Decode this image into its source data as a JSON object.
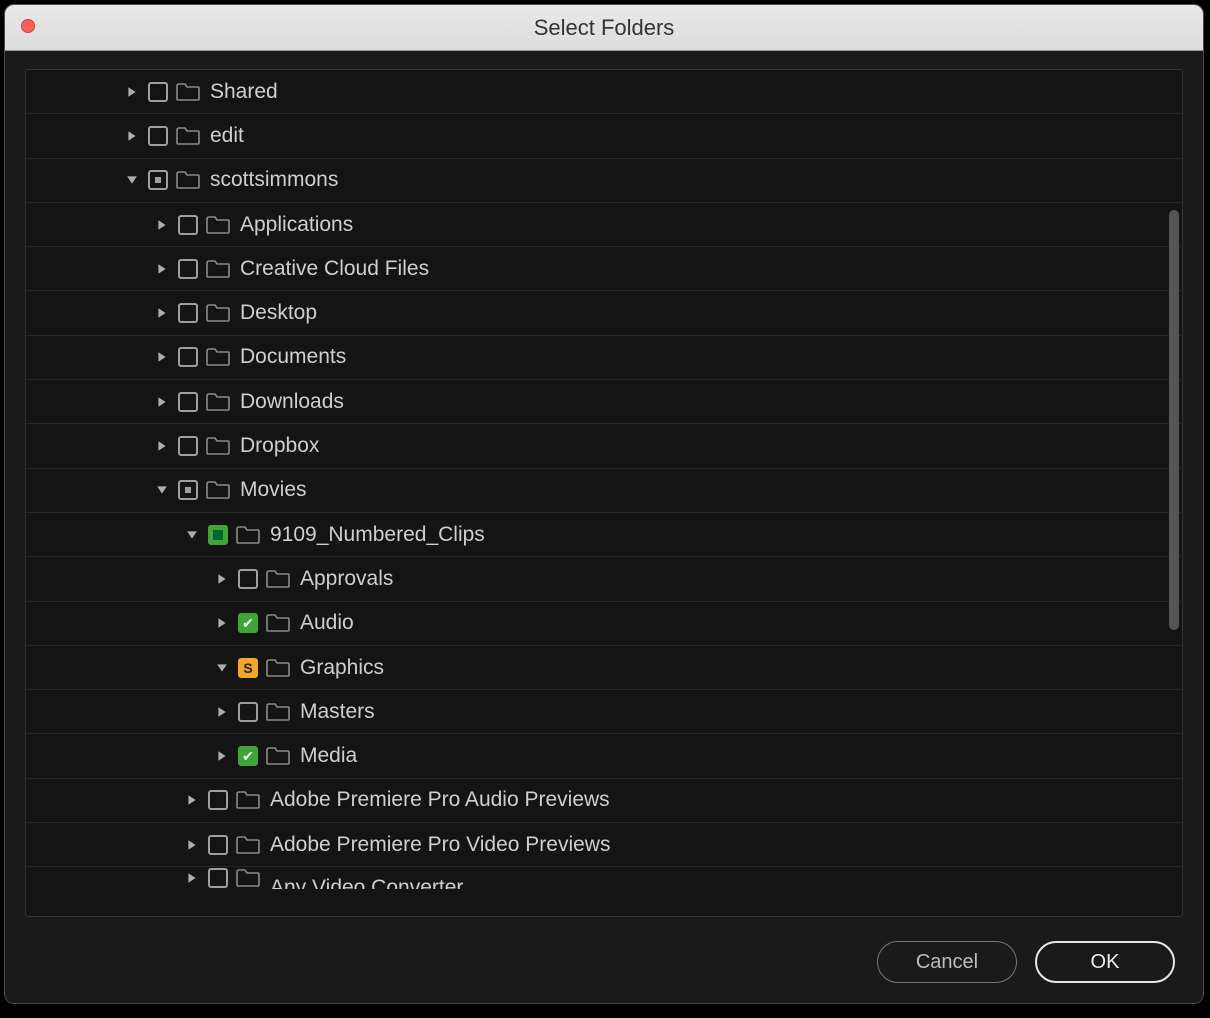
{
  "window": {
    "title": "Select Folders"
  },
  "buttons": {
    "cancel": "Cancel",
    "ok": "OK"
  },
  "tree": [
    {
      "depth": 1,
      "expand": "right",
      "check": "empty",
      "label": "Shared"
    },
    {
      "depth": 1,
      "expand": "right",
      "check": "empty",
      "label": "edit"
    },
    {
      "depth": 1,
      "expand": "down",
      "check": "partial",
      "label": "scottsimmons"
    },
    {
      "depth": 2,
      "expand": "right",
      "check": "empty",
      "label": "Applications"
    },
    {
      "depth": 2,
      "expand": "right",
      "check": "empty",
      "label": "Creative Cloud Files"
    },
    {
      "depth": 2,
      "expand": "right",
      "check": "empty",
      "label": "Desktop"
    },
    {
      "depth": 2,
      "expand": "right",
      "check": "empty",
      "label": "Documents"
    },
    {
      "depth": 2,
      "expand": "right",
      "check": "empty",
      "label": "Downloads"
    },
    {
      "depth": 2,
      "expand": "right",
      "check": "empty",
      "label": "Dropbox"
    },
    {
      "depth": 2,
      "expand": "down",
      "check": "partial",
      "label": "Movies"
    },
    {
      "depth": 3,
      "expand": "down",
      "check": "green-partial",
      "label": "9109_Numbered_Clips"
    },
    {
      "depth": 4,
      "expand": "right",
      "check": "empty",
      "label": "Approvals"
    },
    {
      "depth": 4,
      "expand": "right",
      "check": "checked",
      "label": "Audio"
    },
    {
      "depth": 4,
      "expand": "down",
      "check": "s-badge",
      "label": "Graphics"
    },
    {
      "depth": 4,
      "expand": "right",
      "check": "empty",
      "label": "Masters"
    },
    {
      "depth": 4,
      "expand": "right",
      "check": "checked",
      "label": "Media"
    },
    {
      "depth": 3,
      "expand": "right",
      "check": "empty",
      "label": "Adobe Premiere Pro Audio Previews"
    },
    {
      "depth": 3,
      "expand": "right",
      "check": "empty",
      "label": "Adobe Premiere Pro Video Previews"
    },
    {
      "depth": 3,
      "expand": "right",
      "check": "empty",
      "label": "Any Video Converter",
      "cutoff": true
    }
  ]
}
